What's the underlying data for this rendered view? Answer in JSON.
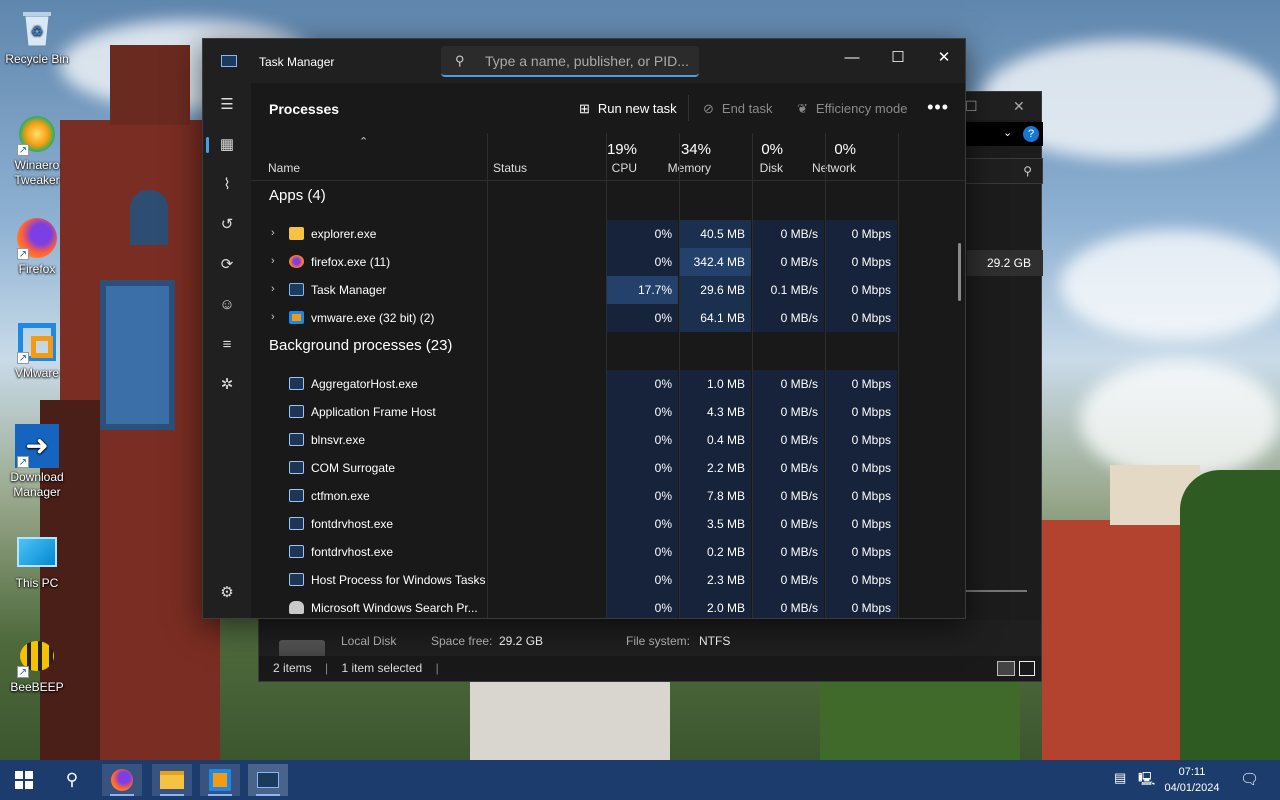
{
  "desktop": {
    "icons": [
      {
        "label": "Recycle Bin",
        "icon": "recycle-bin-icon"
      },
      {
        "label": "Winaero Tweaker",
        "icon": "winaero-tweaker-icon"
      },
      {
        "label": "Firefox",
        "icon": "firefox-icon"
      },
      {
        "label": "VMware",
        "icon": "vmware-icon"
      },
      {
        "label": "Download Manager",
        "icon": "download-manager-icon"
      },
      {
        "label": "This PC",
        "icon": "this-pc-icon"
      },
      {
        "label": "BeeBEEP",
        "icon": "beebeep-icon"
      }
    ]
  },
  "explorer": {
    "drive_size": "29.2 GB",
    "info": {
      "drive_name": "Local Disk",
      "space_free_label": "Space free:",
      "space_free_value": "29.2 GB",
      "fs_label": "File system:",
      "fs_value": "NTFS"
    },
    "status": {
      "items": "2 items",
      "selected": "1 item selected"
    }
  },
  "taskmanager": {
    "title": "Task Manager",
    "search_placeholder": "Type a name, publisher, or PID...",
    "page_title": "Processes",
    "commands": {
      "run_new_task": "Run new task",
      "end_task": "End task",
      "efficiency_mode": "Efficiency mode"
    },
    "columns": {
      "name": "Name",
      "status": "Status",
      "cpu_pct": "19%",
      "cpu": "CPU",
      "mem_pct": "34%",
      "memory": "Memory",
      "disk_pct": "0%",
      "disk": "Disk",
      "net_pct": "0%",
      "network": "Network"
    },
    "groups": {
      "apps": "Apps (4)",
      "background": "Background processes (23)"
    },
    "apps": [
      {
        "name": "explorer.exe",
        "cpu": "0%",
        "memory": "40.5 MB",
        "disk": "0 MB/s",
        "network": "0 Mbps",
        "icon": "folder-icon"
      },
      {
        "name": "firefox.exe (11)",
        "cpu": "0%",
        "memory": "342.4 MB",
        "disk": "0 MB/s",
        "network": "0 Mbps",
        "icon": "firefox-icon"
      },
      {
        "name": "Task Manager",
        "cpu": "17.7%",
        "memory": "29.6 MB",
        "disk": "0.1 MB/s",
        "network": "0 Mbps",
        "icon": "task-manager-icon"
      },
      {
        "name": "vmware.exe (32 bit) (2)",
        "cpu": "0%",
        "memory": "64.1 MB",
        "disk": "0 MB/s",
        "network": "0 Mbps",
        "icon": "vmware-icon"
      }
    ],
    "background": [
      {
        "name": "AggregatorHost.exe",
        "cpu": "0%",
        "memory": "1.0 MB",
        "disk": "0 MB/s",
        "network": "0 Mbps"
      },
      {
        "name": "Application Frame Host",
        "cpu": "0%",
        "memory": "4.3 MB",
        "disk": "0 MB/s",
        "network": "0 Mbps"
      },
      {
        "name": "blnsvr.exe",
        "cpu": "0%",
        "memory": "0.4 MB",
        "disk": "0 MB/s",
        "network": "0 Mbps"
      },
      {
        "name": "COM Surrogate",
        "cpu": "0%",
        "memory": "2.2 MB",
        "disk": "0 MB/s",
        "network": "0 Mbps"
      },
      {
        "name": "ctfmon.exe",
        "cpu": "0%",
        "memory": "7.8 MB",
        "disk": "0 MB/s",
        "network": "0 Mbps"
      },
      {
        "name": "fontdrvhost.exe",
        "cpu": "0%",
        "memory": "3.5 MB",
        "disk": "0 MB/s",
        "network": "0 Mbps"
      },
      {
        "name": "fontdrvhost.exe",
        "cpu": "0%",
        "memory": "0.2 MB",
        "disk": "0 MB/s",
        "network": "0 Mbps"
      },
      {
        "name": "Host Process for Windows Tasks",
        "cpu": "0%",
        "memory": "2.3 MB",
        "disk": "0 MB/s",
        "network": "0 Mbps"
      },
      {
        "name": "Microsoft Windows Search Pr...",
        "cpu": "0%",
        "memory": "2.0 MB",
        "disk": "0 MB/s",
        "network": "0 Mbps"
      }
    ],
    "nav": [
      "menu-icon",
      "processes-icon",
      "performance-icon",
      "app-history-icon",
      "startup-apps-icon",
      "users-icon",
      "details-icon",
      "services-icon",
      "settings-icon"
    ]
  },
  "taskbar": {
    "time": "07:11",
    "date": "04/01/2024"
  },
  "colors": {
    "accent": "#4c9be8",
    "taskbar": "#1d3c6e",
    "tm_bg": "#191919"
  }
}
